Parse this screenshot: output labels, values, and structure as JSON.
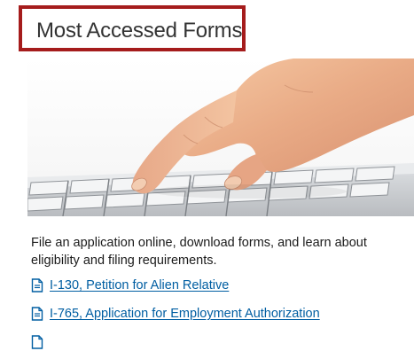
{
  "section": {
    "title": "Most Accessed Forms",
    "highlight_color": "#a51c1c"
  },
  "photo": {
    "icon": "hand-on-keyboard-image"
  },
  "intro_text": "File an application online, download forms, and learn about eligibility and filing requirements.",
  "forms": [
    {
      "label": "I-130, Petition for Alien Relative",
      "icon": "document-icon"
    },
    {
      "label": "I-765, Application for Employment Authorization",
      "icon": "document-icon"
    },
    {
      "label": "",
      "icon": "document-icon"
    }
  ],
  "colors": {
    "link": "#005ea2",
    "text": "#1b1b1b"
  }
}
